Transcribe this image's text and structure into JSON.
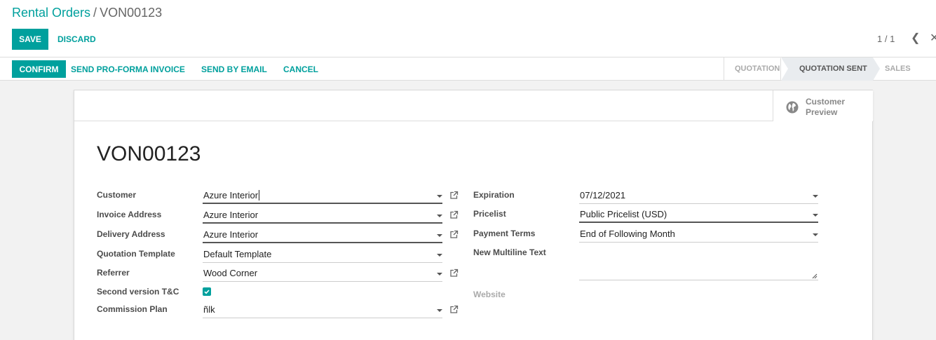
{
  "breadcrumb": {
    "parent": "Rental Orders",
    "separator": "/",
    "current": "VON00123"
  },
  "toolbar": {
    "save_label": "SAVE",
    "discard_label": "DISCARD"
  },
  "pager": {
    "value": "1 / 1"
  },
  "statusbar": {
    "confirm_label": "CONFIRM",
    "proforma_label": "SEND PRO-FORMA INVOICE",
    "email_label": "SEND BY EMAIL",
    "cancel_label": "CANCEL",
    "steps": [
      "QUOTATION",
      "QUOTATION SENT",
      "SALES ORDER"
    ],
    "active_step": "QUOTATION SENT"
  },
  "button_box": {
    "preview_label": "Customer Preview"
  },
  "form": {
    "name": "VON00123",
    "left": {
      "customer": {
        "label": "Customer",
        "value": "Azure Interior"
      },
      "invoice_address": {
        "label": "Invoice Address",
        "value": "Azure Interior"
      },
      "delivery_address": {
        "label": "Delivery Address",
        "value": "Azure Interior"
      },
      "quotation_template": {
        "label": "Quotation Template",
        "value": "Default Template"
      },
      "referrer": {
        "label": "Referrer",
        "value": "Wood Corner"
      },
      "second_version": {
        "label": "Second version T&C",
        "checked": true
      },
      "commission_plan": {
        "label": "Commission Plan",
        "value": "ñlk"
      }
    },
    "right": {
      "expiration": {
        "label": "Expiration",
        "value": "07/12/2021"
      },
      "pricelist": {
        "label": "Pricelist",
        "value": "Public Pricelist (USD)"
      },
      "payment_terms": {
        "label": "Payment Terms",
        "value": "End of Following Month"
      },
      "multiline": {
        "label": "New Multiline Text",
        "value": ""
      },
      "website": {
        "label": "Website"
      }
    }
  },
  "colors": {
    "accent": "#00A09D",
    "text": "#4c4c4c",
    "muted": "#aaaaaa"
  },
  "icons": {
    "globe": "globe-icon",
    "external": "external-link-icon",
    "caret": "caret-down-icon"
  }
}
